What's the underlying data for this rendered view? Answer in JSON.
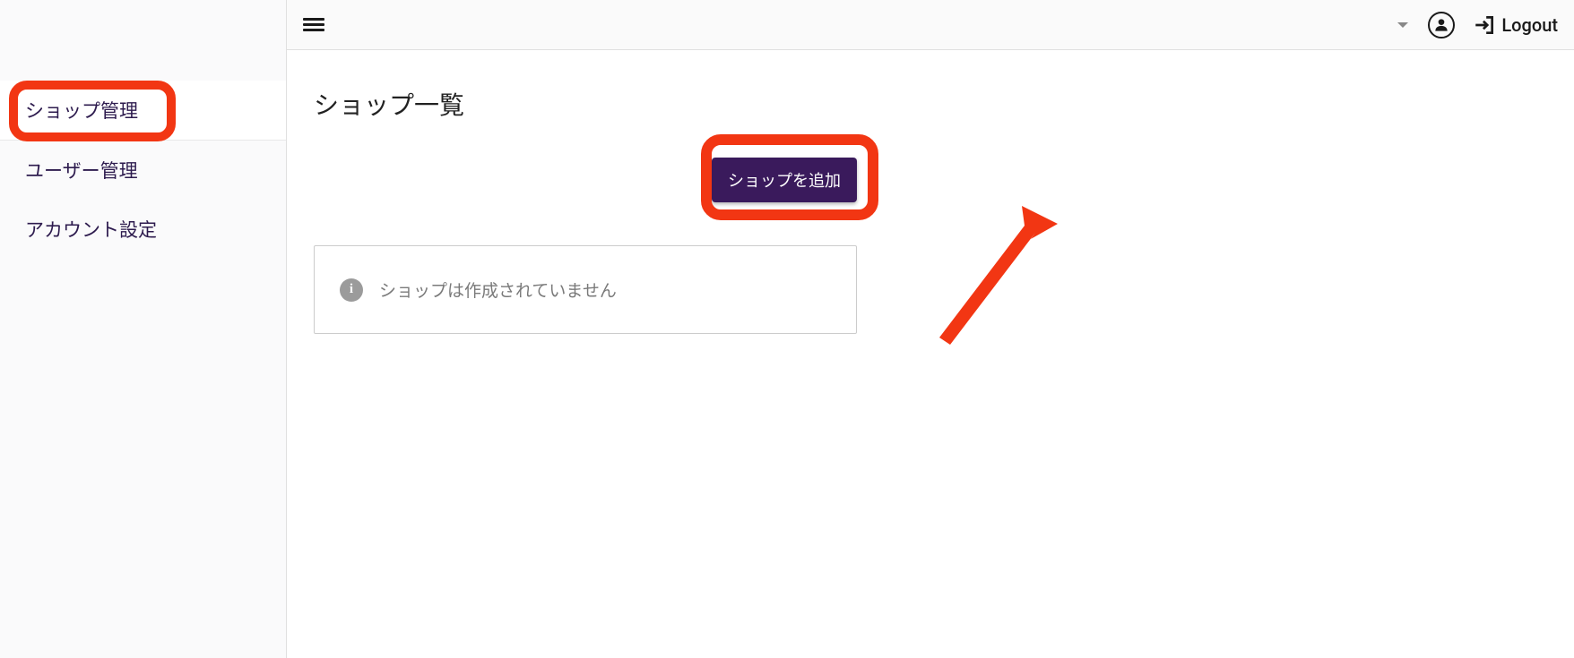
{
  "sidebar": {
    "items": [
      {
        "label": "ショップ管理",
        "active": true
      },
      {
        "label": "ユーザー管理",
        "active": false
      },
      {
        "label": "アカウント設定",
        "active": false
      }
    ]
  },
  "topbar": {
    "logout_label": "Logout"
  },
  "main": {
    "title": "ショップ一覧",
    "add_button_label": "ショップを追加",
    "empty_message": "ショップは作成されていません"
  },
  "colors": {
    "accent": "#3a1a5c",
    "highlight": "#f23613"
  }
}
